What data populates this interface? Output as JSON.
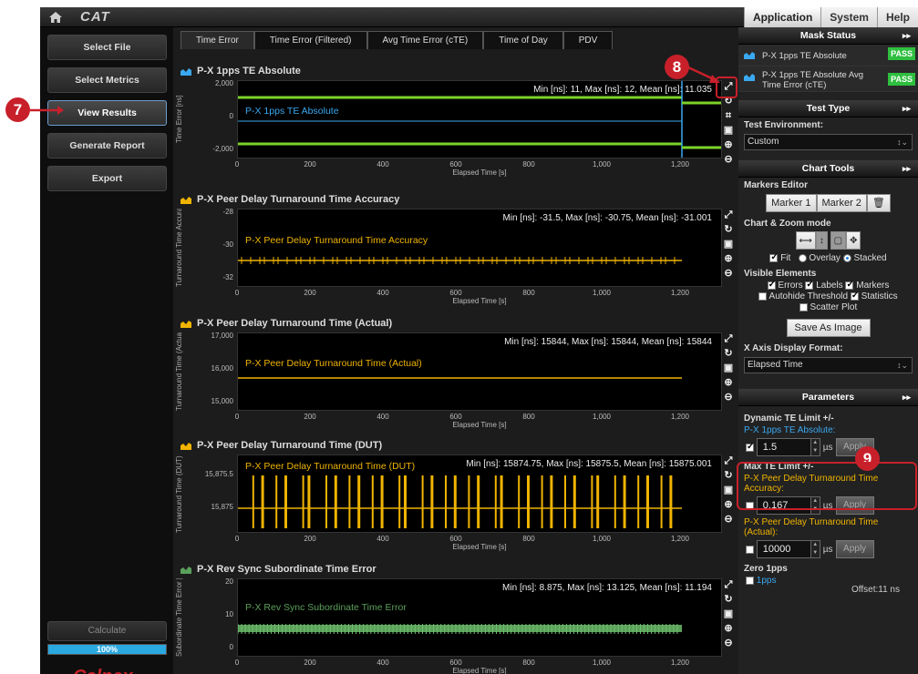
{
  "topbar": {
    "logo": "CAT",
    "menu": [
      "Application",
      "System",
      "Help"
    ]
  },
  "nav": {
    "items": [
      "Select File",
      "Select Metrics",
      "View Results",
      "Generate Report",
      "Export"
    ],
    "calculate": "Calculate",
    "progress": "100%",
    "progress_value": 1.0,
    "brand": "Calnex"
  },
  "tabs": [
    "Time Error",
    "Time Error (Filtered)",
    "Avg Time Error (cTE)",
    "Time of Day",
    "PDV"
  ],
  "xaxis": {
    "label": "Elapsed Time [s]",
    "ticks": [
      "0",
      "200",
      "400",
      "600",
      "800",
      "1,000",
      "1,200"
    ]
  },
  "charts": [
    {
      "title": "P-X 1pps TE Absolute",
      "ylabel": "Time Error [ns]",
      "yticks": [
        "2,000",
        "0",
        "-2,000"
      ],
      "stats": "Min [ns]: 11, Max [ns]: 12, Mean [ns]: 11.035",
      "inlabel": "P-X 1pps TE Absolute",
      "color": "#3aa8f0"
    },
    {
      "title": "P-X Peer Delay Turnaround Time Accuracy",
      "ylabel": "Turnaround Time Accuracy [ns]",
      "yticks": [
        "-28",
        "-30",
        "-32"
      ],
      "stats": "Min [ns]: -31.5, Max [ns]: -30.75, Mean [ns]: -31.001",
      "inlabel": "P-X Peer Delay Turnaround Time Accuracy",
      "color": "#f0b400"
    },
    {
      "title": "P-X Peer Delay Turnaround Time (Actual)",
      "ylabel": "Turnaround Time (Actual) [ns]",
      "yticks": [
        "17,000",
        "16,000",
        "15,000"
      ],
      "stats": "Min [ns]: 15844, Max [ns]: 15844, Mean [ns]: 15844",
      "inlabel": "P-X Peer Delay Turnaround Time (Actual)",
      "color": "#f0b400"
    },
    {
      "title": "P-X Peer Delay Turnaround Time (DUT)",
      "ylabel": "Turnaround Time (DUT) [ns]",
      "yticks": [
        "15,875.5",
        "15,875"
      ],
      "stats": "Min [ns]: 15874.75, Max [ns]: 15875.5, Mean [ns]: 15875.001",
      "inlabel": "P-X Peer Delay Turnaround Time (DUT)",
      "color": "#f0b400"
    },
    {
      "title": "P-X Rev Sync Subordinate Time Error",
      "ylabel": "Subordinate Time Error [ns]",
      "yticks": [
        "20",
        "10",
        "0"
      ],
      "stats": "Min [ns]: 8.875, Max [ns]: 13.125, Mean [ns]: 11.194",
      "inlabel": "P-X Rev Sync Subordinate Time Error",
      "color": "#5aa05a"
    }
  ],
  "right": {
    "mask_status": {
      "title": "Mask Status",
      "rows": [
        {
          "name": "P-X 1pps TE Absolute",
          "status": "PASS"
        },
        {
          "name": "P-X 1pps TE Absolute Avg Time Error (cTE)",
          "status": "PASS"
        }
      ]
    },
    "test_type": {
      "title": "Test Type",
      "env_label": "Test Environment:",
      "env_value": "Custom"
    },
    "chart_tools": {
      "title": "Chart Tools",
      "markers_label": "Markers Editor",
      "marker1": "Marker 1",
      "marker2": "Marker 2",
      "zoom_label": "Chart & Zoom mode",
      "fit": "Fit",
      "overlay": "Overlay",
      "stacked": "Stacked",
      "visible_label": "Visible Elements",
      "errors": "Errors",
      "labels": "Labels",
      "markers": "Markers",
      "autohide": "Autohide Threshold",
      "statistics": "Statistics",
      "scatter": "Scatter Plot",
      "save_image": "Save As Image",
      "xaxis_label": "X Axis Display Format:",
      "xaxis_value": "Elapsed Time"
    },
    "parameters": {
      "title": "Parameters",
      "dyn_label": "Dynamic TE Limit +/-",
      "dyn_sub": "P-X 1pps TE Absolute:",
      "dyn_value": "1.5",
      "unit": "µs",
      "apply": "Apply",
      "max_label": "Max TE Limit +/-",
      "acc_sub": "P-X Peer Delay Turnaround Time Accuracy:",
      "acc_value": "0.167",
      "act_sub": "P-X Peer Delay Turnaround Time (Actual):",
      "act_value": "10000",
      "zero_label": "Zero 1pps",
      "zero_sub": "1pps",
      "offset": "Offset:11 ns"
    }
  },
  "callouts": [
    "7",
    "8",
    "9"
  ]
}
